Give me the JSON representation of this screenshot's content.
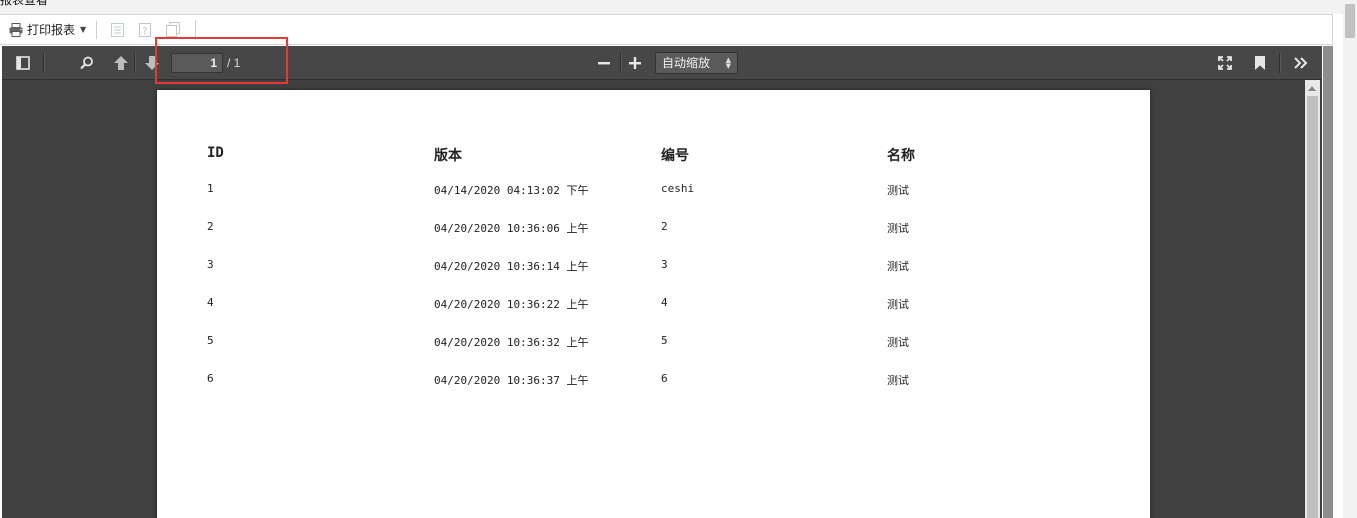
{
  "window": {
    "title": "报表查看"
  },
  "report_toolbar": {
    "print_label": "打印报表",
    "icons": [
      "printer-icon",
      "dropdown-caret-icon",
      "export-icon",
      "help-icon",
      "copy-icon"
    ]
  },
  "viewer_toolbar": {
    "page_number": "1",
    "page_total": "/ 1",
    "zoom_value": "自动缩放",
    "buttons": [
      "sidebar-toggle",
      "find",
      "previous-page",
      "next-page",
      "zoom-out",
      "zoom-in",
      "presentation-mode",
      "bookmark",
      "tools"
    ]
  },
  "report": {
    "headers": [
      "ID",
      "版本",
      "编号",
      "名称"
    ],
    "rows": [
      [
        "1",
        "04/14/2020 04:13:02 下午",
        "ceshi",
        "测试"
      ],
      [
        "2",
        "04/20/2020 10:36:06 上午",
        "2",
        "测试"
      ],
      [
        "3",
        "04/20/2020 10:36:14 上午",
        "3",
        "测试"
      ],
      [
        "4",
        "04/20/2020 10:36:22 上午",
        "4",
        "测试"
      ],
      [
        "5",
        "04/20/2020 10:36:32 上午",
        "5",
        "测试"
      ],
      [
        "6",
        "04/20/2020 10:36:37 上午",
        "6",
        "测试"
      ]
    ]
  },
  "colors": {
    "viewer_background": "#404040",
    "viewer_toolbar": "#474747",
    "highlight_box": "#e53935"
  }
}
